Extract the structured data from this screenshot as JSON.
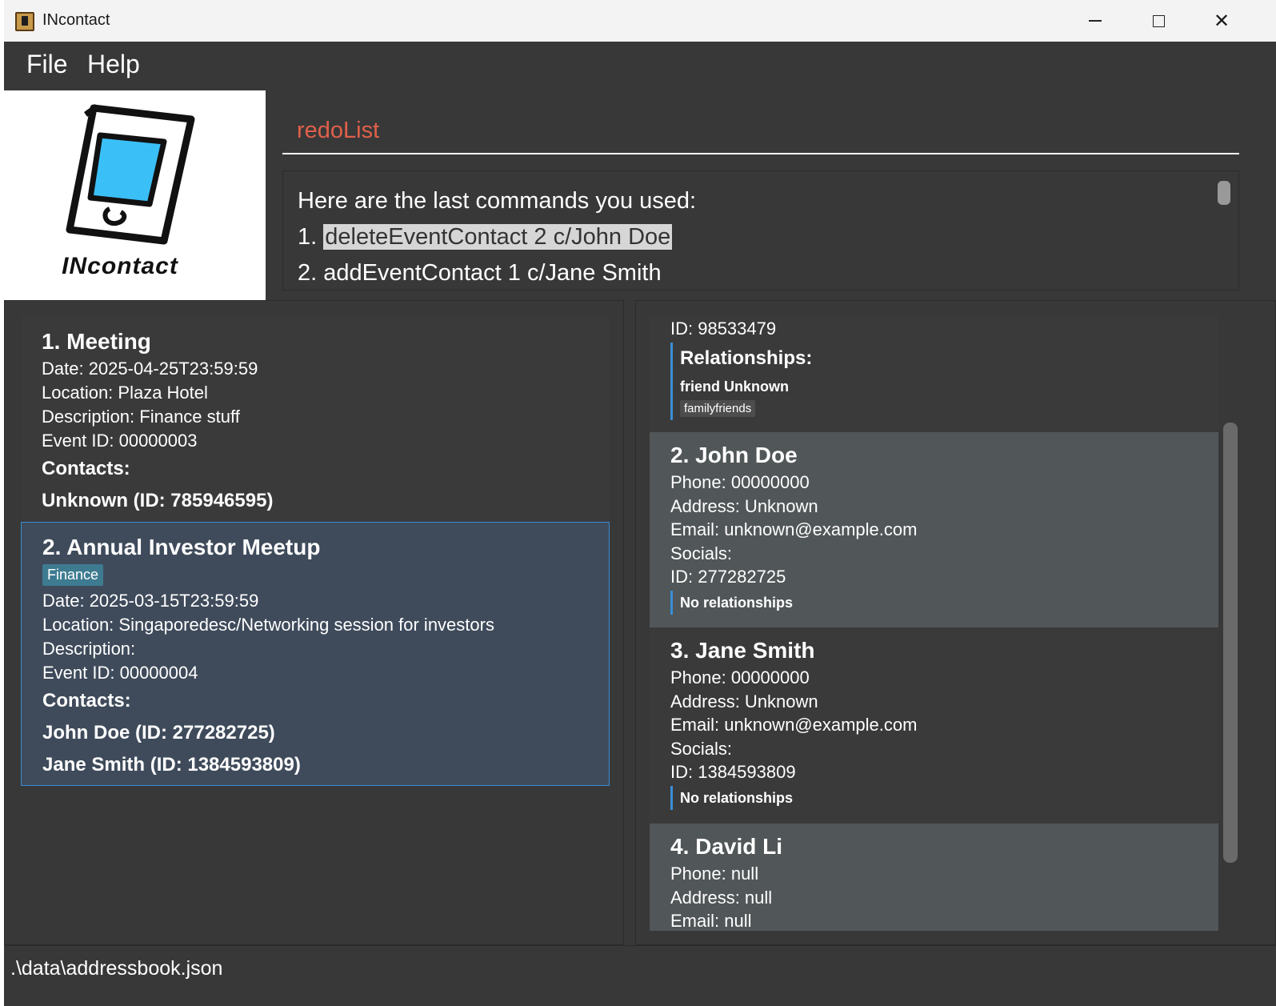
{
  "window": {
    "title": "INcontact"
  },
  "menu": {
    "file": "File",
    "help": "Help"
  },
  "logo": {
    "text": "INcontact"
  },
  "command": {
    "value": "redoList"
  },
  "result": {
    "line0": "Here are the last commands you used:",
    "line1_num": "1. ",
    "line1_cmd": "deleteEventContact 2 c/John Doe",
    "line2": "2. addEventContact 1 c/Jane Smith"
  },
  "events": [
    {
      "title": "1.  Meeting",
      "date": "Date: 2025-04-25T23:59:59",
      "location": "Location: Plaza Hotel",
      "description": "Description: Finance stuff",
      "event_id": "Event ID: 00000003",
      "contacts_label": "Contacts:",
      "contacts": [
        "Unknown (ID: 785946595)"
      ]
    },
    {
      "title": "2.  Annual Investor Meetup",
      "tag": "Finance",
      "date": "Date: 2025-03-15T23:59:59",
      "location": "Location: Singaporedesc/Networking session for investors",
      "description": "Description:",
      "event_id": "Event ID: 00000004",
      "contacts_label": "Contacts:",
      "contacts": [
        "John Doe (ID: 277282725)",
        "Jane Smith (ID: 1384593809)"
      ]
    }
  ],
  "persons": [
    {
      "id": "ID: 98533479",
      "relationships_label": "Relationships:",
      "relationship": "friend  Unknown",
      "relationship_tag": "familyfriends"
    },
    {
      "name": "2. John Doe",
      "phone": "Phone: 00000000",
      "address": "Address: Unknown",
      "email": "Email: unknown@example.com",
      "socials": "Socials:",
      "id": "ID: 277282725",
      "relationships": "No relationships"
    },
    {
      "name": "3. Jane Smith",
      "phone": "Phone: 00000000",
      "address": "Address: Unknown",
      "email": "Email: unknown@example.com",
      "socials": "Socials:",
      "id": "ID: 1384593809",
      "relationships": "No relationships"
    },
    {
      "name": "4. David Li",
      "phone": "Phone: null",
      "address": "Address: null",
      "email": "Email: null"
    }
  ],
  "status": {
    "path": ".\\data\\addressbook.json"
  },
  "colors": {
    "accent": "#3a8ed6",
    "command_text": "#e0604a",
    "selected_card": "#3f4b5b",
    "tag": "#3e7b91"
  }
}
